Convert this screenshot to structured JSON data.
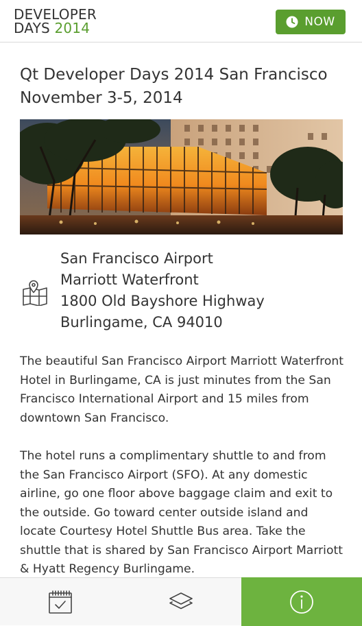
{
  "header": {
    "logo_line1": "DEVELOPER",
    "logo_line2_word": "DAYS",
    "logo_line2_year": "2014",
    "now_label": "NOW",
    "now_icon": "clock-icon",
    "accent_color": "#5a9e2f"
  },
  "event": {
    "title": "Qt Developer Days 2014 San Francisco",
    "date": "November 3-5, 2014"
  },
  "venue": {
    "image_icon": "hotel-photo",
    "map_icon": "map-pin-icon",
    "address": [
      "San Francisco Airport",
      "Marriott Waterfront",
      "1800 Old Bayshore Highway",
      "Burlingame, CA 94010"
    ]
  },
  "description": {
    "paragraph1": "The beautiful San Francisco Airport Marriott Waterfront Hotel in Burlingame, CA is just minutes from the San Francisco International Airport and 15 miles from downtown San Francisco.",
    "paragraph2": "The hotel runs a complimentary shuttle to and from the San Francisco Airport (SFO). At any domestic airline, go one floor above baggage claim and exit to the outside. Go toward center outside island and locate Courtesy Hotel Shuttle Bus area. Take the shuttle that is shared by San Francisco Airport Marriott & Hyatt Regency Burlingame."
  },
  "tabbar": {
    "tabs": [
      {
        "icon": "calendar-icon",
        "active": false
      },
      {
        "icon": "layers-icon",
        "active": false
      },
      {
        "icon": "info-icon",
        "active": true
      }
    ],
    "active_color": "#6db33f"
  }
}
